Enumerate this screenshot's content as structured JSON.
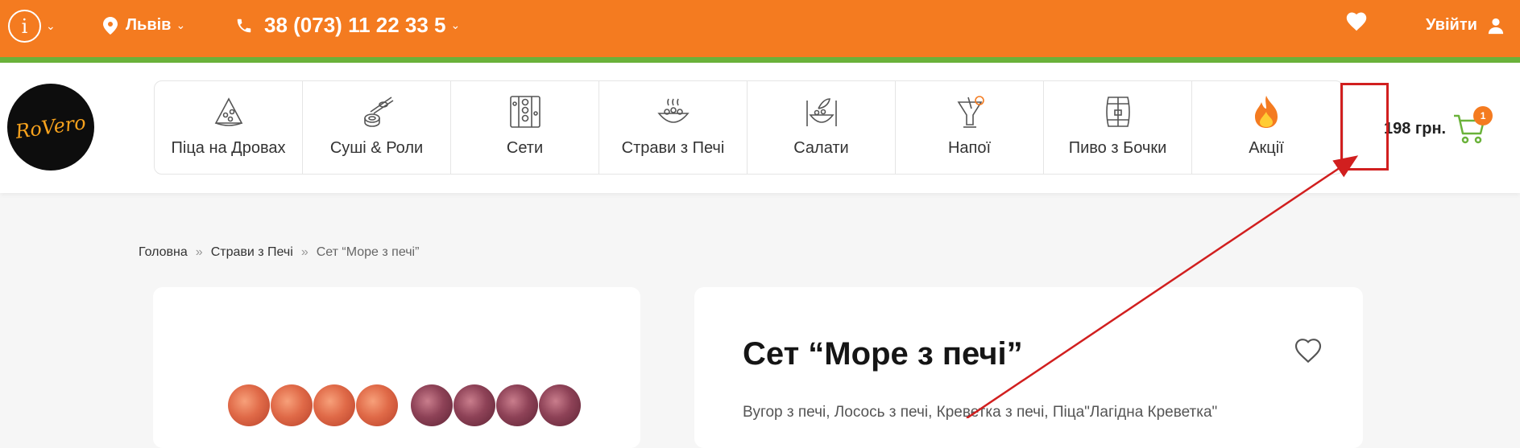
{
  "topbar": {
    "info_icon": "info-icon",
    "city": "Львів",
    "phone": "38 (073) 11 22 33 5",
    "login": "Увійти"
  },
  "logo": {
    "text": "RoVero"
  },
  "nav": {
    "items": [
      {
        "label": "Піца на Дровах",
        "icon": "pizza-icon"
      },
      {
        "label": "Суші & Роли",
        "icon": "sushi-icon"
      },
      {
        "label": "Сети",
        "icon": "sets-icon"
      },
      {
        "label": "Страви з Печі",
        "icon": "oven-dish-icon"
      },
      {
        "label": "Салати",
        "icon": "salad-icon"
      },
      {
        "label": "Напої",
        "icon": "drink-icon"
      },
      {
        "label": "Пиво з Бочки",
        "icon": "beer-barrel-icon"
      },
      {
        "label": "Акції",
        "icon": "fire-icon"
      }
    ]
  },
  "cart": {
    "total": "198 грн.",
    "count": "1"
  },
  "breadcrumb": {
    "home": "Головна",
    "category": "Страви з Печі",
    "current": "Сет “Море з печі”",
    "separator": "»"
  },
  "product": {
    "title": "Сет “Море з печі”",
    "description": "Вугор з печі, Лосось з печі, Креветка з печі, Піца\"Лагідна Креветка\""
  },
  "colors": {
    "topbar": "#f47b20",
    "accent_green": "#6ab23a",
    "annotation": "#d11f1f"
  }
}
